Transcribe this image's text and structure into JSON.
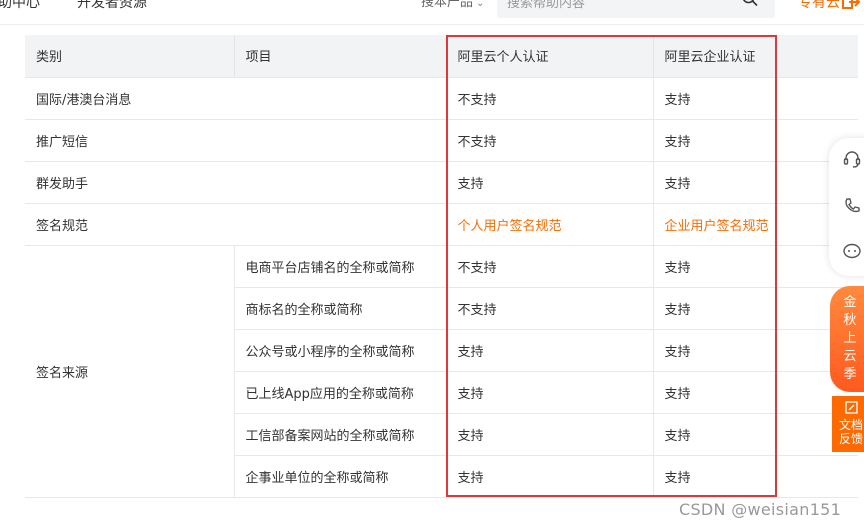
{
  "topbar": {
    "nav": [
      "助中心",
      "开发者资源"
    ],
    "search_product_label": "搜本产品",
    "search_placeholder": "搜索帮助内容",
    "brand_link": "专有云"
  },
  "table": {
    "headers": [
      "类别",
      "项目",
      "阿里云个人认证",
      "阿里云企业认证"
    ],
    "simple_rows": [
      {
        "category": "国际/港澳台消息",
        "personal": "不支持",
        "enterprise": "支持"
      },
      {
        "category": "推广短信",
        "personal": "不支持",
        "enterprise": "支持"
      },
      {
        "category": "群发助手",
        "personal": "支持",
        "enterprise": "支持"
      },
      {
        "category": "签名规范",
        "personal": "个人用户签名规范",
        "enterprise": "企业用户签名规范"
      }
    ],
    "source_group": {
      "category": "签名来源",
      "rows": [
        {
          "item": "电商平台店铺名的全称或简称",
          "personal": "不支持",
          "enterprise": "支持"
        },
        {
          "item": "商标名的全称或简称",
          "personal": "不支持",
          "enterprise": "支持"
        },
        {
          "item": "公众号或小程序的全称或简称",
          "personal": "支持",
          "enterprise": "支持"
        },
        {
          "item": "已上线App应用的全称或简称",
          "personal": "支持",
          "enterprise": "支持"
        },
        {
          "item": "工信部备案网站的全称或简称",
          "personal": "支持",
          "enterprise": "支持"
        },
        {
          "item": "企事业单位的全称或简称",
          "personal": "支持",
          "enterprise": "支持"
        }
      ]
    }
  },
  "side_tools": {
    "promo": "金秋上云季",
    "feedback": "文档反馈"
  },
  "watermark": "CSDN @weisian151",
  "colors": {
    "accent": "#ff6a00",
    "highlight_box": "#e0373b",
    "header_bg": "#f2f3f5"
  }
}
